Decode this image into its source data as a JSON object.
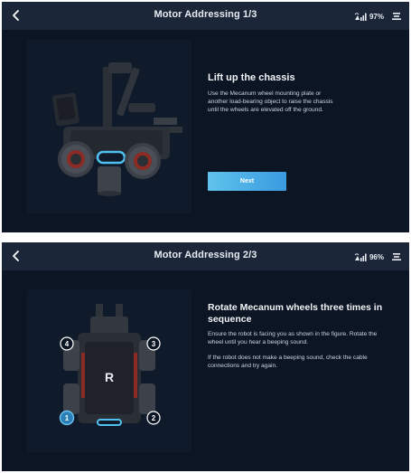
{
  "screens": [
    {
      "title": "Motor Addressing 1/3",
      "battery": "97%",
      "heading": "Lift up the chassis",
      "body": "Use the Mecanum wheel mounting plate or another load-bearing object to raise the chassis until the wheels are elevated off the ground.",
      "button_label": "Next",
      "icons": {
        "back": "chevron-left-icon",
        "signal": "connection-signal-icon",
        "menu": "menu-icon"
      }
    },
    {
      "title": "Motor Addressing 2/3",
      "battery": "96%",
      "heading": "Rotate Mecanum wheels three times in sequence",
      "body": "Ensure the robot is facing you as shown in the figure. Rotate the wheel until you hear a beeping sound.",
      "body2": "If the robot does not make a beeping sound, check the cable connections and try again.",
      "wheel_labels": [
        "1",
        "2",
        "3",
        "4"
      ],
      "logo_mark": "R",
      "icons": {
        "back": "chevron-left-icon",
        "signal": "connection-signal-icon",
        "menu": "menu-icon"
      }
    }
  ],
  "colors": {
    "background": "#0c1523",
    "topbar": "#1b2638",
    "accent": "#4fb3ea",
    "text": "#e8ecf2"
  }
}
